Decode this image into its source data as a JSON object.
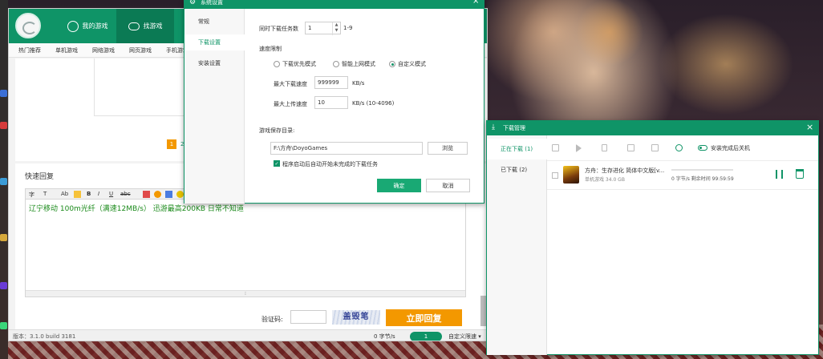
{
  "client": {
    "nav": {
      "my_games": "我的游戏",
      "find_games": "找游戏"
    },
    "subnav": [
      "热门推荐",
      "单机游戏",
      "网络游戏",
      "网页游戏",
      "手机游戏"
    ],
    "pager": {
      "current": "1",
      "next_partial": "2"
    },
    "reply": {
      "title": "快速回复",
      "toolbar": [
        "字",
        "T",
        "Ab",
        "T",
        "B",
        "I",
        "U",
        "abc"
      ],
      "content": "辽宁移动 100m光纤（满速12MB/s） 迅游最高200KB 日常不知道",
      "resize_handle": "⁝",
      "captcha_label": "验证码:",
      "captcha_input": "",
      "captcha_text": "盖毁笔",
      "submit_label": "立即回复"
    },
    "status": {
      "version": "版本：3.1.0 build 3181",
      "speed": "0 字节/s",
      "count": "1",
      "mode": "自定义限速 ▾"
    }
  },
  "settings": {
    "title": "系统设置",
    "close": "×",
    "tabs": [
      "常规",
      "下载设置",
      "安装设置"
    ],
    "active_tab": 1,
    "max_tasks_label": "同时下载任务数",
    "max_tasks_value": "1",
    "max_tasks_range": "1-9",
    "speed_limit_label": "速度限制",
    "modes": [
      "下载优先模式",
      "智能上网模式",
      "自定义模式"
    ],
    "selected_mode": 2,
    "max_download_label": "最大下载速度",
    "max_download_value": "999999",
    "max_download_unit": "KB/s",
    "max_upload_label": "最大上传速度",
    "max_upload_value": "10",
    "max_upload_unit": "KB/s (10-4096)",
    "save_dir_label": "游戏保存目录:",
    "save_dir_value": "F:\\方舟\\DoyoGames",
    "browse_label": "浏览",
    "autostart_checked": true,
    "autostart_label": "程序启动后自动开始未完成的下载任务",
    "confirm_label": "确定",
    "cancel_label": "取消"
  },
  "download_manager": {
    "title": "下载管理",
    "close": "×",
    "tabs": [
      "正在下载 (1)",
      "已下载 (2)"
    ],
    "active_tab": 0,
    "auto_shutdown_label": "安装完成后关机",
    "tasks": [
      {
        "name": "方舟：生存进化 简体中文版[v...",
        "meta": "单机游戏  34.0 GB",
        "rate": "0 字节/s 剩余时间 99:59:59",
        "progress_percent": 0
      }
    ]
  },
  "colors": {
    "brand_green": "#0f9467",
    "accent_orange": "#f39800",
    "editor_text_green": "#1a8a1a"
  }
}
